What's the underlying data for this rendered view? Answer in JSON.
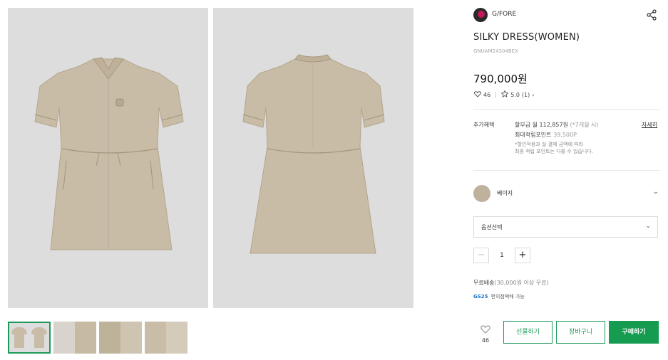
{
  "brand": {
    "name": "G/FORE"
  },
  "product": {
    "title": "SILKY DRESS(WOMEN)",
    "code": "GNUAM24304BEX",
    "price": "790,000원",
    "likes": "46",
    "rating": "5.0",
    "reviews": "(1)"
  },
  "benefits": {
    "label": "추가혜택",
    "installment": "할부금 월 112,857원",
    "installment_note": "(*7개월 시)",
    "points_label": "최대적립포인트",
    "points_value": "39,500P",
    "note_line1": "*할인적용과 실 결제 금액에 따라",
    "note_line2": "최종 적립 포인트는 다를 수 있습니다.",
    "detail_link": "자세히"
  },
  "color": {
    "name": "베이지",
    "swatch": "#bfb29d"
  },
  "option": {
    "placeholder": "옵션선택"
  },
  "quantity": {
    "value": "1",
    "minus": "−",
    "plus": "+"
  },
  "shipping": {
    "text": "무료배송",
    "condition": "(30,000원 이상 무료)"
  },
  "gs25": {
    "logo": "GS25",
    "text": "편의점택배 가능"
  },
  "actions": {
    "wish_count": "46",
    "gift": "선물하기",
    "cart": "장바구니",
    "buy": "구매하기"
  },
  "colors": {
    "accent": "#1e9a5a",
    "buy_bg": "#169c51",
    "dress": "#c9bca6",
    "photo_bg": "#dddddd"
  },
  "icons": [
    "share-icon",
    "heart-icon",
    "star-icon",
    "chevron-down-icon"
  ]
}
